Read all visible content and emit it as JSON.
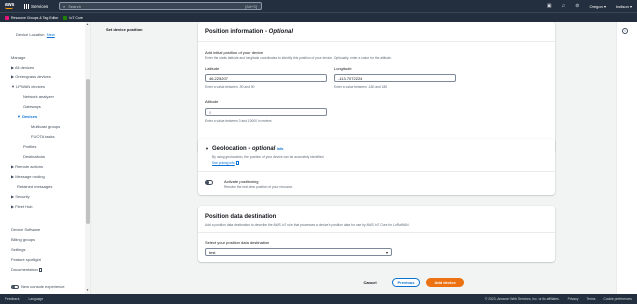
{
  "topnav": {
    "logo": "aws",
    "services_label": "Services",
    "search_placeholder": "Search",
    "search_shortcut": "[Alt+S]",
    "region": "Oregon ▾",
    "account": "Indison ▾"
  },
  "favorites": [
    {
      "label": "Resource Groups & Tag Editor",
      "color": "#e7157b"
    },
    {
      "label": "IoT Core",
      "color": "#1d8102"
    }
  ],
  "sidebar": {
    "items": [
      {
        "label": "Device Location",
        "link": "New",
        "indent": 1
      },
      {
        "label": "Manage",
        "indent": 0
      },
      {
        "label": "▶  All devices",
        "indent": 0
      },
      {
        "label": "▶  Greengrass devices",
        "indent": 0
      },
      {
        "label": "▼  LPWAN devices",
        "indent": 0
      },
      {
        "label": "Network analyzer",
        "indent": 1
      },
      {
        "label": "Gateways",
        "indent": 1
      },
      {
        "label": "▼  Devices",
        "indent": 1,
        "active": true
      },
      {
        "label": "Multicast groups",
        "indent": 2
      },
      {
        "label": "FUOTA tasks",
        "indent": 2
      },
      {
        "label": "Profiles",
        "indent": 1
      },
      {
        "label": "Destinations",
        "indent": 1
      },
      {
        "label": "▶  Remote actions",
        "indent": 0
      },
      {
        "label": "▶  Message routing",
        "indent": 0
      },
      {
        "label": "Retained messages",
        "indent": 0
      },
      {
        "label": "▶  Security",
        "indent": 0
      },
      {
        "label": "▶  Fleet Hub",
        "indent": 0
      },
      {
        "label": "Device Software",
        "indent": 0
      },
      {
        "label": "Billing groups",
        "indent": 0
      },
      {
        "label": "Settings",
        "indent": 0
      },
      {
        "label": "Feature spotlight",
        "indent": 0
      },
      {
        "label": "Documentation",
        "indent": 0,
        "external": true
      }
    ],
    "new_console_label": "New console experience"
  },
  "main": {
    "step_label": "Set device position",
    "position_info": {
      "title": "Position information - ",
      "title_optional": "Optional",
      "subtitle": "Add initial position of your device",
      "subtitle_desc": "Enter the static latitude and longitude coordinates to identify this position of your device. Optionally, enter a value for the altitude.",
      "latitude_label": "Latitude",
      "latitude_value": "46.225207",
      "latitude_hint": "Enter a value between -90 and 90",
      "longitude_label": "Longitude",
      "longitude_value": "-113.7072224",
      "longitude_hint": "Enter a value between -180 and 180",
      "altitude_label": "Altitude",
      "altitude_value": "0",
      "altitude_hint": "Enter a value between 0 and 10000 in meters"
    },
    "geolocation": {
      "title": "Geolocation - ",
      "title_optional": "optional",
      "info": "Info",
      "desc": "By using geolocation, the position of your device can be accurately identified.",
      "pricing_link": "See pricing info",
      "toggle_label": "Activate positioning",
      "toggle_desc": "Resolve the real-time position of your resource."
    },
    "destination": {
      "title": "Position data destination",
      "desc": "Add a position data destination to describe the AWS IoT rule that processes a device's position data for use by AWS IoT Core for LoRaWAN.",
      "select_label": "Select your position data destination",
      "select_value": "test"
    },
    "buttons": {
      "cancel": "Cancel",
      "previous": "Previous",
      "add": "Add device"
    }
  },
  "footer": {
    "feedback": "Feedback",
    "language": "Language",
    "copyright": "© 2023, Amazon Web Services, Inc. or its affiliates.",
    "privacy": "Privacy",
    "terms": "Terms",
    "cookies": "Cookie preferences"
  }
}
